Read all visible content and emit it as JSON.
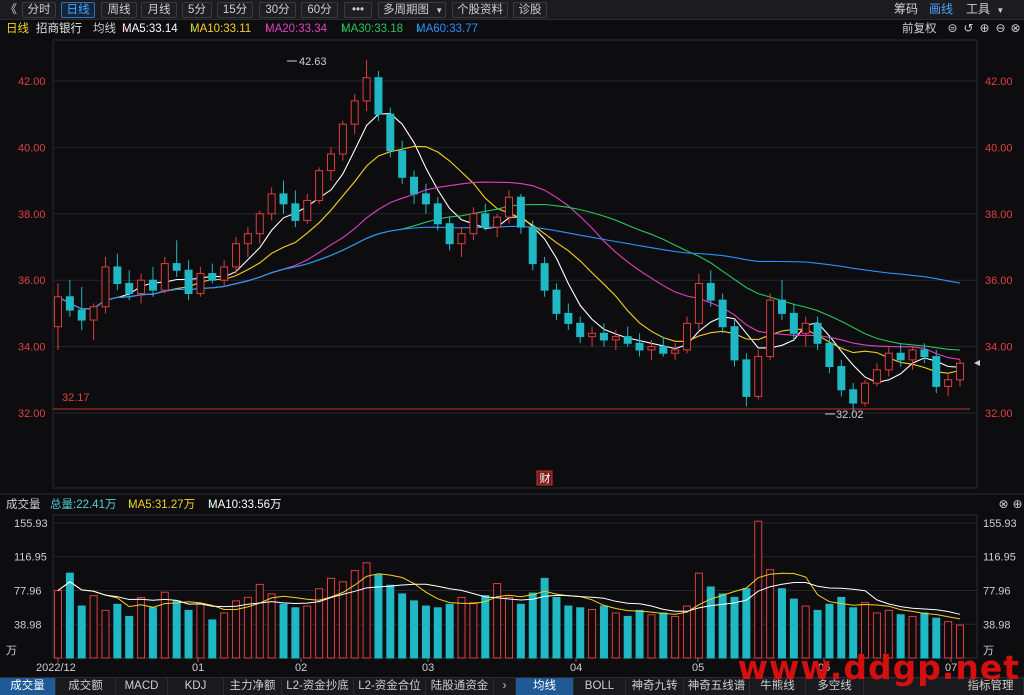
{
  "toolbar": {
    "back": "《",
    "items": [
      "分时",
      "日线",
      "周线",
      "月线",
      "5分",
      "15分",
      "30分",
      "60分",
      "•••",
      "多周期图",
      "个股资料",
      "诊股"
    ],
    "dropdown_caret": "▼",
    "right_items": [
      "筹码",
      "画线",
      "工具"
    ],
    "tools_caret": "▼"
  },
  "ma_legend": {
    "period": "日线",
    "stock": "招商银行",
    "avg": "均线",
    "ma5": "MA5:33.14",
    "ma10": "MA10:33.11",
    "ma20": "MA20:33.34",
    "ma30": "MA30:33.18",
    "ma60": "MA60:33.77",
    "adjust": "前复权",
    "colors": {
      "ma5": "#ffffff",
      "ma10": "#f5d020",
      "ma20": "#e040c0",
      "ma30": "#29c45a",
      "ma60": "#2f8fff"
    }
  },
  "vol_legend": {
    "label": "成交量",
    "total": "总量:22.41万",
    "ma5": "MA5:31.27万",
    "ma10": "MA10:33.56万"
  },
  "price_axis": {
    "ticks": [
      "42.00",
      "40.00",
      "38.00",
      "36.00",
      "34.00",
      "32.00"
    ],
    "high_label": "42.63",
    "low_label": "32.02",
    "ref_label": "32.17",
    "finance_badge": "财"
  },
  "volume_axis": {
    "ticks": [
      "155.93",
      "116.95",
      "77.96",
      "38.98"
    ],
    "unit": "万"
  },
  "x_axis": {
    "labels": [
      "2022/12",
      "01",
      "02",
      "03",
      "04",
      "05",
      "06",
      "07"
    ]
  },
  "bottom_tabs": {
    "left": [
      "成交量",
      "成交额",
      "MACD",
      "KDJ",
      "主力净额",
      "L2-资金抄底",
      "L2-资金合位",
      "陆股通资金"
    ],
    "right": [
      "均线",
      "BOLL",
      "神奇九转",
      "神奇五线谱",
      "牛熊线",
      "多空线"
    ],
    "more": "指标管理",
    "next": "›"
  },
  "watermark": "www.ddgp.net",
  "chart_data": {
    "type": "candlestick",
    "title": "招商银行 日线",
    "price_range": [
      31.5,
      43.5
    ],
    "volume_range": [
      0,
      160
    ],
    "candles_ohlc_approx": [
      [
        34.6,
        35.9,
        33.9,
        35.5
      ],
      [
        35.5,
        36.0,
        34.9,
        35.1
      ],
      [
        35.1,
        35.8,
        34.5,
        34.8
      ],
      [
        34.8,
        35.3,
        34.2,
        35.2
      ],
      [
        35.2,
        36.7,
        35.0,
        36.4
      ],
      [
        36.4,
        36.8,
        35.7,
        35.9
      ],
      [
        35.9,
        36.3,
        35.4,
        35.6
      ],
      [
        35.6,
        36.2,
        35.3,
        36.0
      ],
      [
        36.0,
        36.4,
        35.5,
        35.7
      ],
      [
        35.7,
        36.7,
        35.6,
        36.5
      ],
      [
        36.5,
        37.2,
        36.1,
        36.3
      ],
      [
        36.3,
        36.6,
        35.4,
        35.6
      ],
      [
        35.6,
        36.4,
        35.5,
        36.2
      ],
      [
        36.2,
        36.5,
        35.9,
        36.0
      ],
      [
        36.0,
        36.6,
        35.8,
        36.4
      ],
      [
        36.4,
        37.3,
        36.2,
        37.1
      ],
      [
        37.1,
        37.6,
        36.7,
        37.4
      ],
      [
        37.4,
        38.1,
        37.1,
        38.0
      ],
      [
        38.0,
        38.8,
        37.8,
        38.6
      ],
      [
        38.6,
        39.0,
        38.0,
        38.3
      ],
      [
        38.3,
        38.7,
        37.6,
        37.8
      ],
      [
        37.8,
        38.6,
        37.7,
        38.4
      ],
      [
        38.4,
        39.4,
        38.3,
        39.3
      ],
      [
        39.3,
        40.0,
        39.0,
        39.8
      ],
      [
        39.8,
        40.8,
        39.6,
        40.7
      ],
      [
        40.7,
        41.6,
        40.4,
        41.4
      ],
      [
        41.4,
        42.63,
        41.1,
        42.1
      ],
      [
        42.1,
        42.3,
        40.8,
        41.0
      ],
      [
        41.0,
        41.2,
        39.7,
        39.9
      ],
      [
        39.9,
        40.2,
        38.9,
        39.1
      ],
      [
        39.1,
        39.3,
        38.3,
        38.6
      ],
      [
        38.6,
        38.9,
        38.0,
        38.3
      ],
      [
        38.3,
        38.5,
        37.5,
        37.7
      ],
      [
        37.7,
        37.9,
        36.9,
        37.1
      ],
      [
        37.1,
        37.6,
        36.7,
        37.4
      ],
      [
        37.4,
        38.2,
        37.2,
        38.0
      ],
      [
        38.0,
        38.3,
        37.5,
        37.6
      ],
      [
        37.6,
        38.0,
        37.3,
        37.9
      ],
      [
        37.9,
        38.7,
        37.7,
        38.5
      ],
      [
        38.5,
        38.6,
        37.4,
        37.6
      ],
      [
        37.6,
        37.8,
        36.3,
        36.5
      ],
      [
        36.5,
        36.7,
        35.5,
        35.7
      ],
      [
        35.7,
        35.9,
        34.8,
        35.0
      ],
      [
        35.0,
        35.3,
        34.5,
        34.7
      ],
      [
        34.7,
        34.9,
        34.1,
        34.3
      ],
      [
        34.3,
        34.6,
        34.0,
        34.4
      ],
      [
        34.4,
        34.7,
        34.0,
        34.2
      ],
      [
        34.2,
        34.5,
        33.9,
        34.3
      ],
      [
        34.3,
        34.6,
        34.0,
        34.1
      ],
      [
        34.1,
        34.4,
        33.7,
        33.9
      ],
      [
        33.9,
        34.2,
        33.6,
        34.0
      ],
      [
        34.0,
        34.3,
        33.7,
        33.8
      ],
      [
        33.8,
        34.1,
        33.6,
        33.9
      ],
      [
        33.9,
        34.9,
        33.8,
        34.7
      ],
      [
        34.7,
        36.2,
        34.5,
        35.9
      ],
      [
        35.9,
        36.3,
        35.2,
        35.4
      ],
      [
        35.4,
        35.6,
        34.4,
        34.6
      ],
      [
        34.6,
        34.8,
        33.4,
        33.6
      ],
      [
        33.6,
        33.8,
        32.2,
        32.5
      ],
      [
        32.5,
        33.9,
        32.4,
        33.7
      ],
      [
        33.7,
        35.6,
        33.6,
        35.4
      ],
      [
        35.4,
        36.0,
        34.8,
        35.0
      ],
      [
        35.0,
        35.3,
        34.2,
        34.4
      ],
      [
        34.4,
        34.9,
        34.0,
        34.7
      ],
      [
        34.7,
        34.9,
        33.9,
        34.1
      ],
      [
        34.1,
        34.3,
        33.2,
        33.4
      ],
      [
        33.4,
        33.6,
        32.5,
        32.7
      ],
      [
        32.7,
        32.9,
        32.02,
        32.3
      ],
      [
        32.3,
        33.0,
        32.2,
        32.9
      ],
      [
        32.9,
        33.5,
        32.8,
        33.3
      ],
      [
        33.3,
        34.0,
        33.1,
        33.8
      ],
      [
        33.8,
        34.1,
        33.4,
        33.6
      ],
      [
        33.6,
        34.0,
        33.3,
        33.9
      ],
      [
        33.9,
        34.1,
        33.5,
        33.7
      ],
      [
        33.7,
        33.9,
        32.6,
        32.8
      ],
      [
        32.8,
        33.2,
        32.5,
        33.0
      ],
      [
        33.0,
        33.6,
        32.8,
        33.5
      ]
    ],
    "volumes_approx": [
      78,
      98,
      60,
      72,
      55,
      62,
      48,
      70,
      58,
      76,
      66,
      55,
      63,
      44,
      52,
      66,
      70,
      85,
      74,
      62,
      58,
      60,
      80,
      92,
      88,
      101,
      110,
      96,
      84,
      74,
      66,
      60,
      58,
      62,
      70,
      64,
      72,
      86,
      70,
      62,
      75,
      92,
      70,
      60,
      58,
      56,
      60,
      52,
      48,
      55,
      50,
      52,
      48,
      60,
      98,
      82,
      74,
      70,
      80,
      158,
      102,
      80,
      68,
      60,
      55,
      62,
      70,
      58,
      64,
      52,
      55,
      50,
      48,
      52,
      46,
      42,
      38
    ]
  }
}
